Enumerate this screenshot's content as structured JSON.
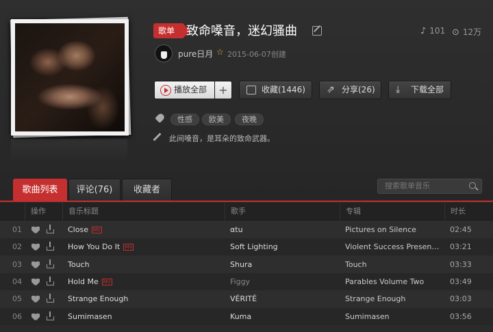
{
  "playlist": {
    "badge": "歌单",
    "title": "致命嗓音，迷幻骚曲",
    "play_count_label": "101",
    "listen_count_label": "12万",
    "creator": "pure日月",
    "created": "2015-06-07创建",
    "tags": [
      "性感",
      "欧美",
      "夜晚"
    ],
    "description": "此间嗓音，是耳朵的致命武器。"
  },
  "actions": {
    "play_all": "播放全部",
    "add": "+",
    "favorite": "收藏(1446)",
    "share": "分享(26)",
    "download": "下载全部"
  },
  "tabs": [
    "歌曲列表",
    "评论(76)",
    "收藏者"
  ],
  "search": {
    "placeholder": "搜索歌单音乐"
  },
  "table": {
    "headers": [
      "操作",
      "音乐标题",
      "歌手",
      "专辑",
      "时长"
    ],
    "rows": [
      {
        "num": "01",
        "title": "Close",
        "mv": true,
        "artist": "αtu",
        "album": "Pictures on Silence",
        "duration": "02:45"
      },
      {
        "num": "02",
        "title": "How You Do It",
        "mv": true,
        "artist": "Soft Lighting",
        "album": "Violent Success Presents...",
        "duration": "03:21"
      },
      {
        "num": "03",
        "title": "Touch",
        "mv": false,
        "artist": "Shura",
        "album": "Touch",
        "duration": "03:33"
      },
      {
        "num": "04",
        "title": "Hold Me",
        "mv": true,
        "artist": "Figgy",
        "album": "Parables Volume Two",
        "duration": "03:49"
      },
      {
        "num": "05",
        "title": "Strange Enough",
        "mv": false,
        "artist": "VÉRITÉ",
        "album": "Strange Enough",
        "duration": "03:03"
      },
      {
        "num": "06",
        "title": "Sumimasen",
        "mv": false,
        "artist": "Kuma",
        "album": "Sumimasen",
        "duration": "03:56"
      }
    ]
  },
  "colors": {
    "accent": "#c62f2f"
  },
  "icons": [
    "play-circle-icon",
    "folder-icon",
    "share-icon",
    "download-icon",
    "tag-icon",
    "pencil-icon",
    "note-icon",
    "play-count-icon",
    "heart-icon",
    "search-icon",
    "edit-icon",
    "star-icon"
  ]
}
